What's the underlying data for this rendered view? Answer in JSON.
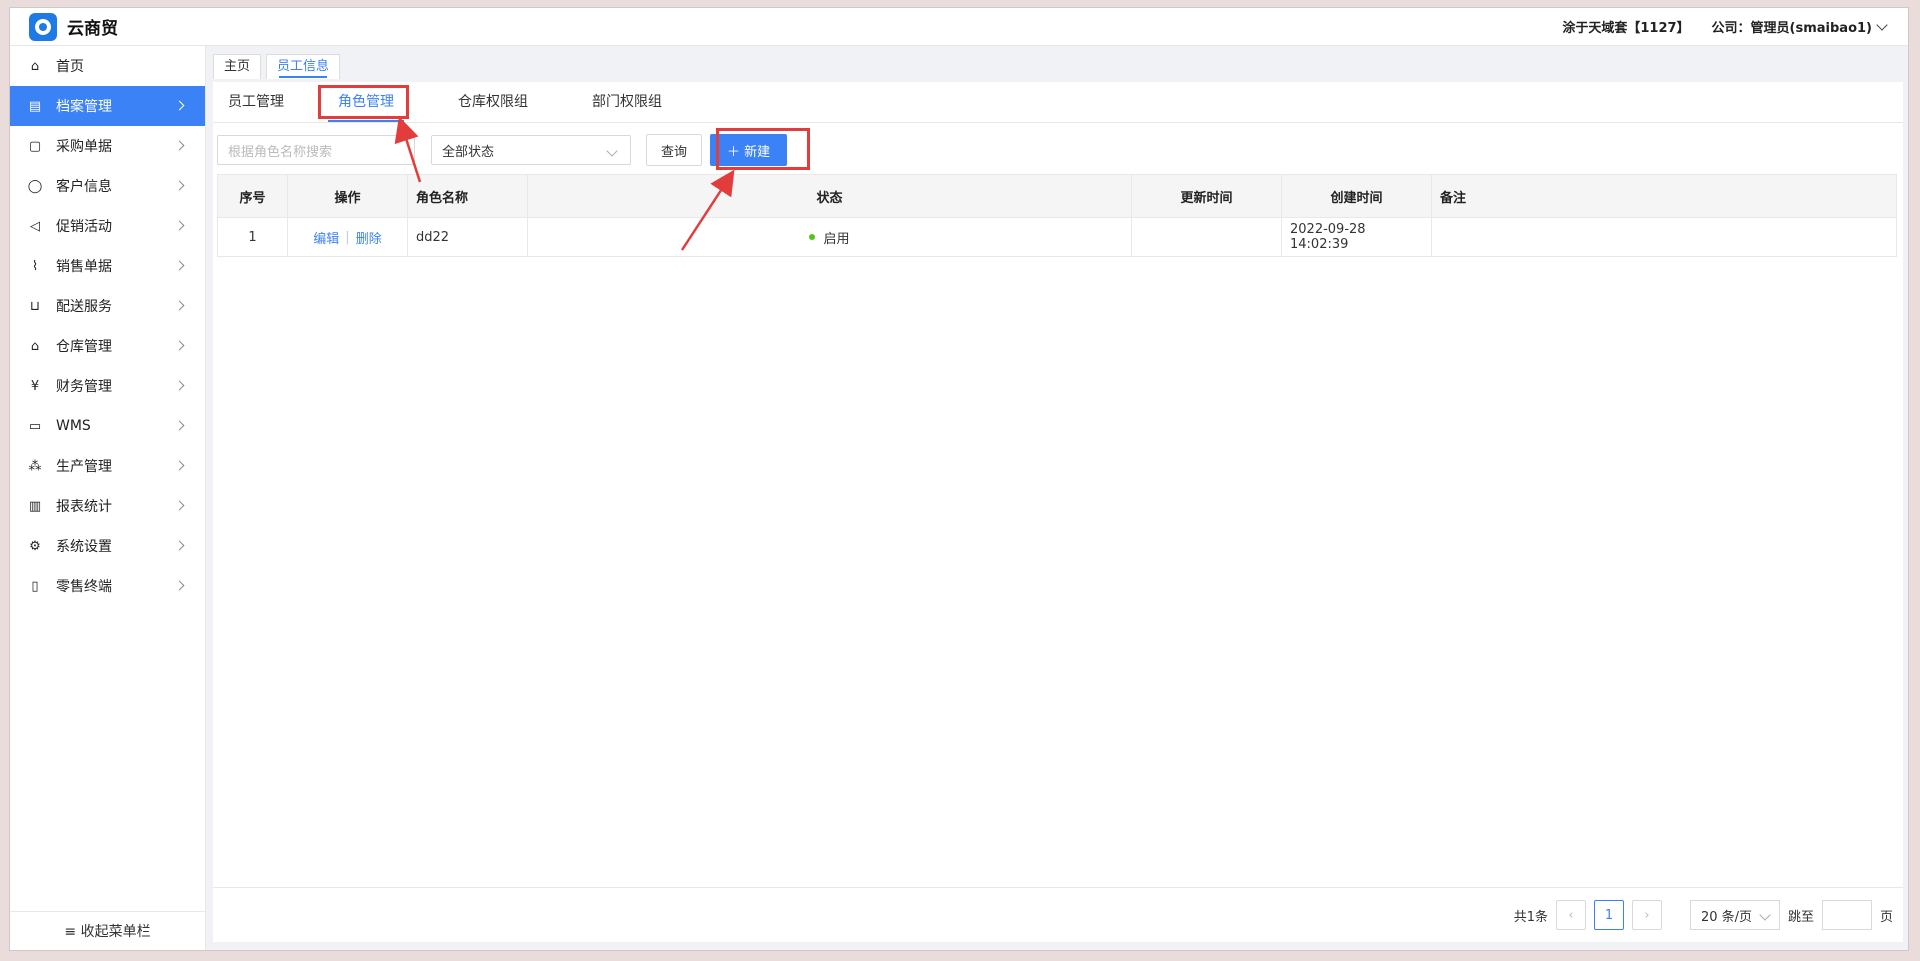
{
  "header": {
    "title": "云商贸",
    "company_info": "涂于天域套【1127】",
    "user_info": "公司：管理员(smaibao1)"
  },
  "sidebar": {
    "items": [
      {
        "label": "首页",
        "icon": "home-icon",
        "glyph": "⌂"
      },
      {
        "label": "档案管理",
        "icon": "archive-icon",
        "glyph": "▤"
      },
      {
        "label": "采购单据",
        "icon": "document-icon",
        "glyph": "▢"
      },
      {
        "label": "客户信息",
        "icon": "user-icon",
        "glyph": "◯"
      },
      {
        "label": "促销活动",
        "icon": "megaphone-icon",
        "glyph": "◁"
      },
      {
        "label": "销售单据",
        "icon": "chart-line-icon",
        "glyph": "⌇"
      },
      {
        "label": "配送服务",
        "icon": "cart-icon",
        "glyph": "⊔"
      },
      {
        "label": "仓库管理",
        "icon": "warehouse-icon",
        "glyph": "⌂"
      },
      {
        "label": "财务管理",
        "icon": "finance-icon",
        "glyph": "¥"
      },
      {
        "label": "WMS",
        "icon": "truck-icon",
        "glyph": "▭"
      },
      {
        "label": "生产管理",
        "icon": "production-icon",
        "glyph": "⁂"
      },
      {
        "label": "报表统计",
        "icon": "bar-chart-icon",
        "glyph": "▥"
      },
      {
        "label": "系统设置",
        "icon": "gear-icon",
        "glyph": "⚙"
      },
      {
        "label": "零售终端",
        "icon": "bag-icon",
        "glyph": "▯"
      }
    ],
    "collapse_label": "≡ 收起菜单栏"
  },
  "page_tabs": [
    "主页",
    "员工信息"
  ],
  "sub_tabs": [
    "员工管理",
    "角色管理",
    "仓库权限组",
    "部门权限组"
  ],
  "toolbar": {
    "search_placeholder": "根据角色名称搜索",
    "status_select": "全部状态",
    "query_label": "查询",
    "new_label": "＋ 新建"
  },
  "table": {
    "headers": [
      "序号",
      "操作",
      "角色名称",
      "状态",
      "更新时间",
      "创建时间",
      "备注"
    ],
    "rows": [
      {
        "index": "1",
        "edit": "编辑",
        "delete": "删除",
        "name": "dd22",
        "status": "启用",
        "updated": "",
        "created": "2022-09-28 14:02:39",
        "note": ""
      }
    ]
  },
  "pagination": {
    "total": "共1条",
    "current_page": "1",
    "page_size": "20 条/页",
    "jump_label": "跳至",
    "page_unit": "页",
    "prev": "‹",
    "next": "›"
  },
  "colors": {
    "accent": "#3b82f6",
    "highlight": "#e23c3c",
    "status_enabled": "#52c41a"
  }
}
